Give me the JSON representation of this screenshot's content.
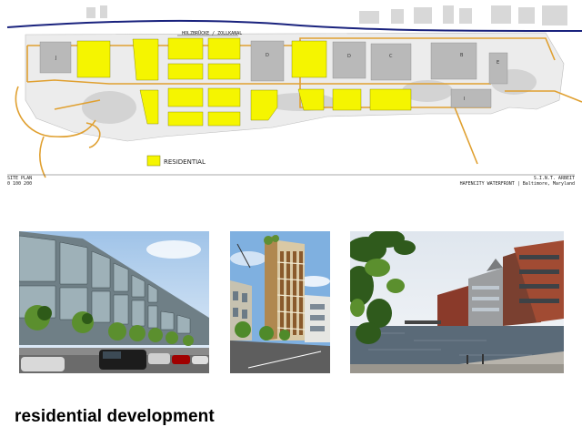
{
  "site_plan": {
    "legend": {
      "label": "RESIDENTIAL",
      "color": "#f5f500"
    },
    "title_left": "SITE PLAN",
    "subtitle_left": "0 100 200",
    "title_right": "S.I.N.T. ARBEIT",
    "subtitle_right": "HAFENCITY WATERFRONT | Baltimore, Maryland",
    "street_label": "HOLZBRÜCKE / ZOLLKANAL",
    "block_labels": [
      "J",
      "D",
      "D",
      "C",
      "G",
      "B",
      "E",
      "I"
    ]
  },
  "photos": [
    {
      "name": "terraced-apartment-rows"
    },
    {
      "name": "residential-tower"
    },
    {
      "name": "canal-waterfront"
    }
  ],
  "caption": "residential development",
  "colors": {
    "residential": "#f5f500",
    "water": "#1a237e",
    "road": "#e0a030"
  }
}
